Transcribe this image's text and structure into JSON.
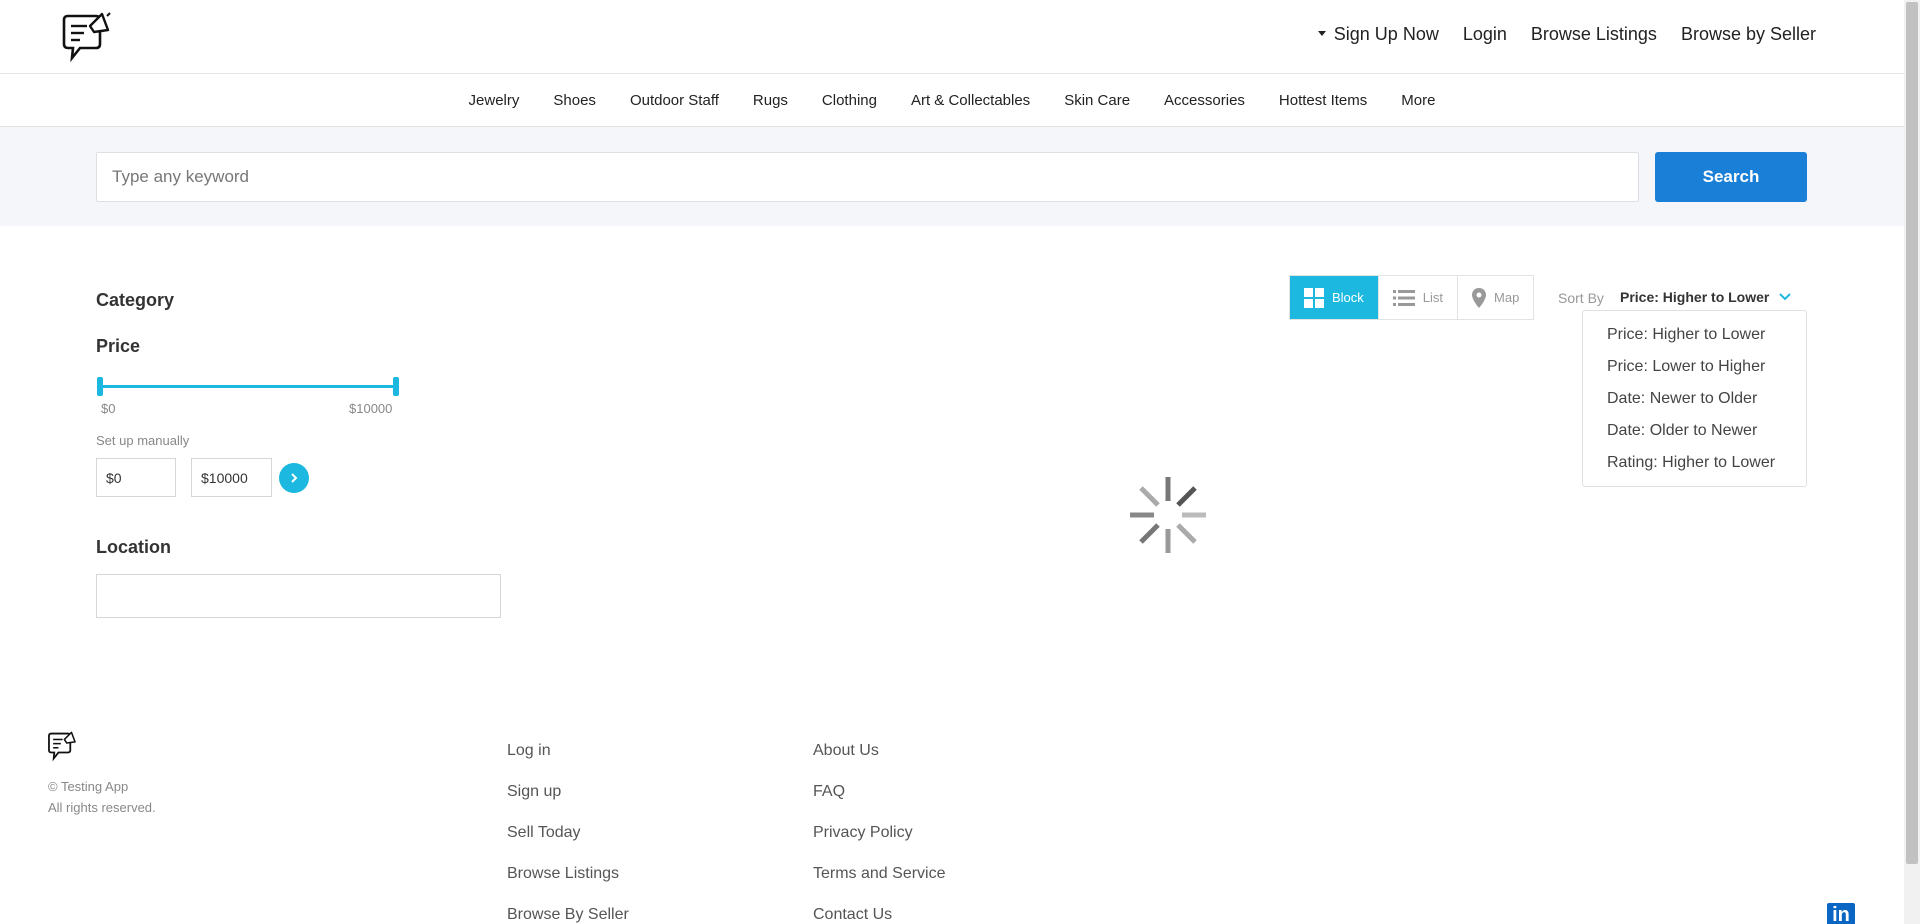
{
  "header": {
    "nav": [
      {
        "label": "Sign Up Now"
      },
      {
        "label": "Login"
      },
      {
        "label": "Browse Listings"
      },
      {
        "label": "Browse by Seller"
      }
    ]
  },
  "categories": [
    "Jewelry",
    "Shoes",
    "Outdoor Staff",
    "Rugs",
    "Clothing",
    "Art & Collectables",
    "Skin Care",
    "Accessories",
    "Hottest Items",
    "More"
  ],
  "search": {
    "placeholder": "Type any keyword",
    "button_label": "Search"
  },
  "filters": {
    "category_title": "Category",
    "price_title": "Price",
    "slider_min_label": "$0",
    "slider_max_label": "$10000",
    "manual_label": "Set up manually",
    "currency_symbol": "$",
    "min_value": "0",
    "max_value": "10000",
    "location_title": "Location",
    "location_value": ""
  },
  "views": {
    "block": "Block",
    "list": "List",
    "map": "Map",
    "active": "block"
  },
  "sort": {
    "label": "Sort By",
    "selected": "Price: Higher to Lower",
    "options": [
      "Price: Higher to Lower",
      "Price: Lower to Higher",
      "Date: Newer to Older",
      "Date: Older to Newer",
      "Rating: Higher to Lower"
    ]
  },
  "footer": {
    "copyright": "© Testing App",
    "rights": "All rights reserved.",
    "col1": [
      "Log in",
      "Sign up",
      "Sell Today",
      "Browse Listings",
      "Browse By Seller"
    ],
    "col2": [
      "About Us",
      "FAQ",
      "Privacy Policy",
      "Terms and Service",
      "Contact Us"
    ]
  },
  "colors": {
    "accent": "#1cb8e0",
    "search_button": "#1a7fd6",
    "linkedin": "#0a66c2"
  },
  "icons": [
    "chat-megaphone-logo",
    "caret-down-icon",
    "grid-icon",
    "list-icon",
    "map-pin-icon",
    "chevron-down-icon",
    "chevron-right-icon",
    "loading-spinner",
    "linkedin-icon"
  ]
}
